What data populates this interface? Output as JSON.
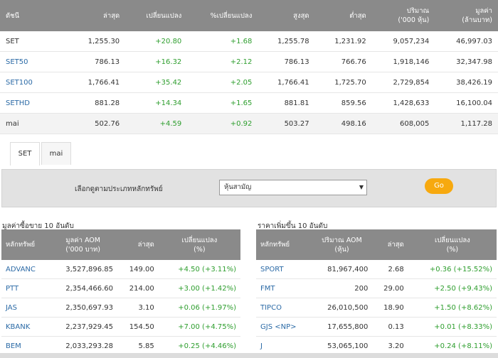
{
  "index_table": {
    "headers": [
      "ดัชนี",
      "ล่าสุด",
      "เปลี่ยนแปลง",
      "%เปลี่ยนแปลง",
      "สูงสุด",
      "ต่ำสุด",
      "ปริมาณ\n('000 หุ้น)",
      "มูลค่า\n(ล้านบาท)"
    ],
    "rows": [
      [
        "SET",
        "1,255.30",
        "+20.80",
        "+1.68",
        "1,255.78",
        "1,231.92",
        "9,057,234",
        "46,997.03"
      ],
      [
        "SET50",
        "786.13",
        "+16.32",
        "+2.12",
        "786.13",
        "766.76",
        "1,918,146",
        "32,347.98"
      ],
      [
        "SET100",
        "1,766.41",
        "+35.42",
        "+2.05",
        "1,766.41",
        "1,725.70",
        "2,729,854",
        "38,426.19"
      ],
      [
        "SETHD",
        "881.28",
        "+14.34",
        "+1.65",
        "881.81",
        "859.56",
        "1,428,633",
        "16,100.04"
      ],
      [
        "mai",
        "502.76",
        "+4.59",
        "+0.92",
        "503.27",
        "498.16",
        "608,005",
        "1,117.28"
      ]
    ]
  },
  "tabs": [
    "SET",
    "mai"
  ],
  "filter": {
    "label": "เลือกดูตามประเภทหลักทรัพย์",
    "select_value": "หุ้นสามัญ",
    "go_label": "Go"
  },
  "top_value": {
    "title": "มูลค่าซื้อขาย 10 อันดับ",
    "headers": [
      "หลักทรัพย์",
      "มูลค่า AOM\n('000 บาท)",
      "ล่าสุด",
      "เปลี่ยนแปลง\n(%)"
    ],
    "rows": [
      [
        "ADVANC",
        "3,527,896.85",
        "149.00",
        "+4.50 (+3.11%)"
      ],
      [
        "PTT",
        "2,354,466.60",
        "214.00",
        "+3.00 (+1.42%)"
      ],
      [
        "JAS",
        "2,350,697.93",
        "3.10",
        "+0.06 (+1.97%)"
      ],
      [
        "KBANK",
        "2,237,929.45",
        "154.50",
        "+7.00 (+4.75%)"
      ],
      [
        "BEM",
        "2,033,293.28",
        "5.85",
        "+0.25 (+4.46%)"
      ]
    ]
  },
  "top_gainers": {
    "title": "ราคาเพิ่มขึ้น 10 อันดับ",
    "headers": [
      "หลักทรัพย์",
      "ปริมาณ AOM\n(หุ้น)",
      "ล่าสุด",
      "เปลี่ยนแปลง\n(%)"
    ],
    "rows": [
      [
        "SPORT",
        "81,967,400",
        "2.68",
        "+0.36 (+15.52%)"
      ],
      [
        "FMT",
        "200",
        "29.00",
        "+2.50 (+9.43%)"
      ],
      [
        "TIPCO",
        "26,010,500",
        "18.90",
        "+1.50 (+8.62%)"
      ],
      [
        "GJS <NP>",
        "17,655,800",
        "0.13",
        "+0.01 (+8.33%)"
      ],
      [
        "J",
        "53,065,100",
        "3.20",
        "+0.24 (+8.11%)"
      ]
    ]
  },
  "colors": {
    "header_bg": "#8a8a8a",
    "positive": "#2e9e2e",
    "link": "#2b6aa6",
    "go_button": "#f7a90f"
  }
}
